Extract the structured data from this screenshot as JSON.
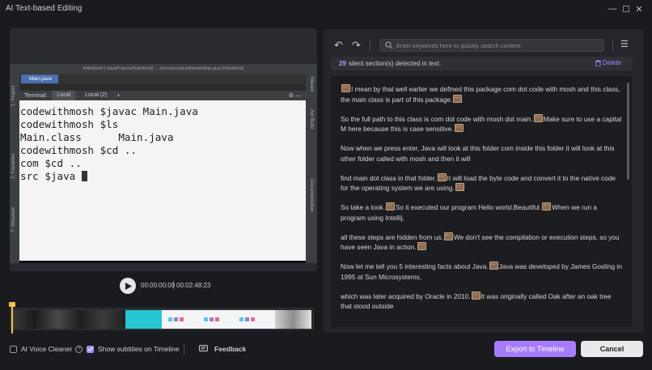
{
  "window": {
    "title": "AI Text-based Editing",
    "controls": {
      "minimize": "—",
      "maximize": "☐",
      "close": "✕"
    }
  },
  "video": {
    "ide_title": "HelloWorld [~/IdeaProjects/HelloWorld] - .../src/com/codewithmosh/Main.java [HelloWorld]",
    "editor_tab": "Main.java",
    "terminal_label": "Terminal:",
    "terminal_tabs": [
      "Local",
      "Local (2)"
    ],
    "terminal_add": "+",
    "left_strip_labels": [
      "1: Project",
      "2: Favorites",
      "7: Structure"
    ],
    "right_strip_labels": [
      "Maven",
      "Ant Build",
      "Documentation"
    ],
    "terminal_lines": [
      "codewithmosh $javac Main.java",
      "codewithmosh $ls",
      "Main.class      Main.java",
      "codewithmosh $cd ..",
      "com $cd ..",
      "src $java "
    ],
    "current_time": "00:00:00:00",
    "duration": "00:02:48:23"
  },
  "timeline": {
    "playhead_fraction": 0.0
  },
  "text_panel": {
    "search_placeholder": "Enter keywords here to quickly search content",
    "silent_count": "29",
    "silent_text": "silent section(s) detected in text.",
    "delete_label": "Delete",
    "paragraphs": [
      [
        "",
        "I mean by that well earlier we defined this package com dot code with mosh and this class, the main class is part of this package.",
        ""
      ],
      [
        "So the full path to this class is com dot code with mosh dot main.",
        "Make sure to use a capital M here because this is case sensitive.",
        ""
      ],
      [
        "Now when we press enter, Java will look at this folder com inside this folder it will look at this other folder called with mosh and then it will"
      ],
      [
        " find main dot class in that folder.",
        "It will load the byte code and convert it to the native code for the operating system we are using.",
        ""
      ],
      [
        "So take a look.",
        "So it executed our program Hello world.Beautiful.",
        "When we run a program using Intellij,"
      ],
      [
        " all these steps are hidden from us.",
        "We don't see the compilation or execution steps, so you have seen Java in action.",
        ""
      ],
      [
        "Now let me tell you 5 interesting facts about Java.",
        "Java was developed by James Gosling in 1995 at Sun Microsystems,"
      ],
      [
        " which was later acquired by Oracle in 2010.",
        "It was originally called Oak after an oak tree that stood outside"
      ]
    ]
  },
  "footer": {
    "voice_cleaner_label": "AI Voice Cleaner",
    "voice_cleaner_checked": false,
    "subtitles_label": "Show subtitles on Timeline",
    "subtitles_checked": true,
    "feedback_label": "Feedback",
    "export_label": "Export to Timeline",
    "cancel_label": "Cancel"
  },
  "colors": {
    "accent": "#a67cff",
    "playhead": "#f6c445",
    "silence_marker": "#8a6a52"
  }
}
